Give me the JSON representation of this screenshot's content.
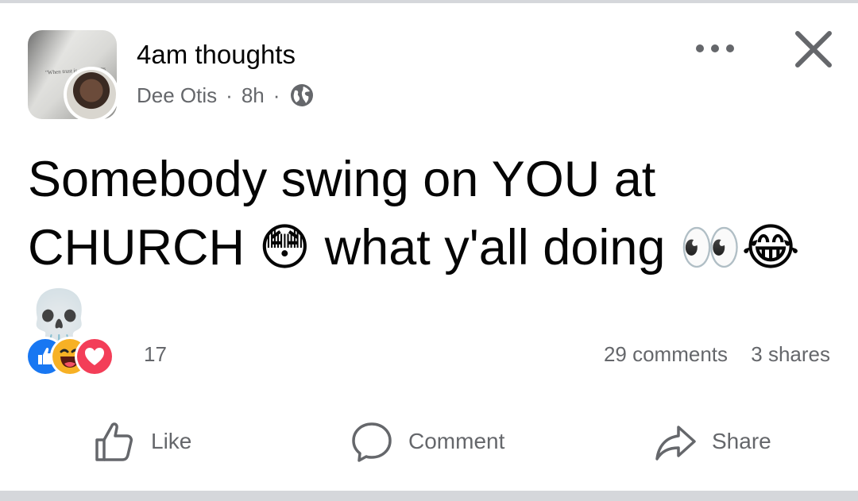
{
  "post": {
    "group_name": "4am thoughts",
    "author": "Dee Otis",
    "separator": "·",
    "time": "8h",
    "privacy_icon": "globe-icon",
    "text": "Somebody swing on YOU at\nCHURCH 😳 what y'all doing 👀😂\n💀",
    "avatar_quote": "\"When trust is\nsorry means"
  },
  "header_actions": {
    "more_icon": "more-horizontal-icon",
    "close_icon": "close-icon"
  },
  "reactions": {
    "types": [
      "like",
      "haha",
      "love"
    ],
    "count": "17",
    "colors": {
      "like": "#1877f2",
      "haha": "#f7b125",
      "love": "#f33e58"
    }
  },
  "stats": {
    "comments": "29 comments",
    "shares": "3 shares"
  },
  "actions": {
    "like_label": "Like",
    "comment_label": "Comment",
    "share_label": "Share"
  }
}
